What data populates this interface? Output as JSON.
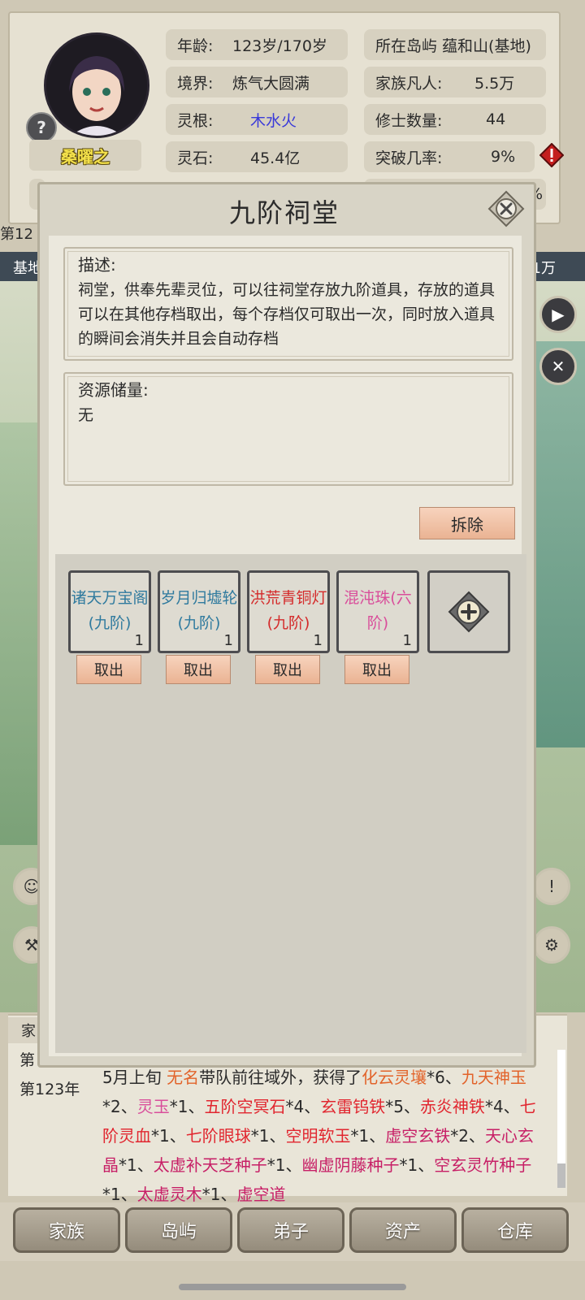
{
  "header": {
    "name": "桑曜之",
    "help": "?",
    "stats": {
      "age_label": "年龄:",
      "age_value": "123岁/170岁",
      "realm_label": "境界:",
      "realm_value": "炼气大圆满",
      "root_label": "灵根:",
      "root_value": "木水火",
      "stone_label": "灵石:",
      "stone_value": "45.4亿",
      "island": "所在岛屿 蕴和山(基地)",
      "mortals_label": "家族凡人:",
      "mortals_value": "5.5万",
      "cultivators_label": "修士数量:",
      "cultivators_value": "44",
      "breakthrough_label": "突破几率:",
      "breakthrough_value": "9%"
    },
    "partial_right_text": "%",
    "side_left_text": "第12",
    "base_bar_left": "基地",
    "base_bar_right": "1万"
  },
  "dialog": {
    "title": "九阶祠堂",
    "desc_label": "描述:",
    "desc_text": "祠堂，供奉先辈灵位，可以往祠堂存放九阶道具，存放的道具可以在其他存档取出，每个存档仅可取出一次，同时放入道具的瞬间会消失并且会自动存档",
    "resource_label": "资源储量:",
    "resource_value": "无",
    "dismantle": "拆除",
    "take_label": "取出",
    "items": [
      {
        "name": "诸天万宝阁(九阶)",
        "count": "1",
        "color": "#2f7a9e"
      },
      {
        "name": "岁月归墟轮(九阶)",
        "count": "1",
        "color": "#2f7a9e"
      },
      {
        "name": "洪荒青铜灯(九阶)",
        "count": "1",
        "color": "#d42a2a"
      },
      {
        "name": "混沌珠(六阶)",
        "count": "1",
        "color": "#d94e9b"
      }
    ]
  },
  "log": {
    "tab": "家",
    "year_prev": "第",
    "year": "第123年",
    "line": "5月上旬 无名带队前往域外，获得了化云灵壤*6、九天神玉*2、灵玉*1、五阶空冥石*4、玄雷钨铁*5、赤炎神铁*4、七阶灵血*1、七阶眼球*1、空明软玉*1、虚空玄铁*2、天心玄晶*1、太虚补天芝种子*1、幽虚阴藤种子*1、空玄灵竹种子*1、太虚灵木*1、虚空道",
    "segments": [
      {
        "t": "5月上旬 ",
        "c": ""
      },
      {
        "t": "无名",
        "c": "o"
      },
      {
        "t": "带队前往域外，获得了",
        "c": ""
      },
      {
        "t": "化云灵壤",
        "c": "o"
      },
      {
        "t": "*6、",
        "c": ""
      },
      {
        "t": "九天神玉",
        "c": "o"
      },
      {
        "t": "*2、",
        "c": ""
      },
      {
        "t": "灵玉",
        "c": "p"
      },
      {
        "t": "*1、",
        "c": ""
      },
      {
        "t": "五阶空冥石",
        "c": "r"
      },
      {
        "t": "*4、",
        "c": ""
      },
      {
        "t": "玄雷钨铁",
        "c": "r"
      },
      {
        "t": "*5、",
        "c": ""
      },
      {
        "t": "赤炎神铁",
        "c": "r"
      },
      {
        "t": "*4、",
        "c": ""
      },
      {
        "t": "七阶灵血",
        "c": "r"
      },
      {
        "t": "*1、",
        "c": ""
      },
      {
        "t": "七阶眼球",
        "c": "r"
      },
      {
        "t": "*1、",
        "c": ""
      },
      {
        "t": "空明软玉",
        "c": "r"
      },
      {
        "t": "*1、",
        "c": ""
      },
      {
        "t": "虚空玄铁",
        "c": "m"
      },
      {
        "t": "*2、",
        "c": ""
      },
      {
        "t": "天心玄晶",
        "c": "m"
      },
      {
        "t": "*1、",
        "c": ""
      },
      {
        "t": "太虚补天芝种子",
        "c": "m"
      },
      {
        "t": "*1、",
        "c": ""
      },
      {
        "t": "幽虚阴藤种子",
        "c": "m"
      },
      {
        "t": "*1、",
        "c": ""
      },
      {
        "t": "空玄灵竹种子",
        "c": "m"
      },
      {
        "t": "*1、",
        "c": ""
      },
      {
        "t": "太虚灵木",
        "c": "m"
      },
      {
        "t": "*1、",
        "c": ""
      },
      {
        "t": "虚空道",
        "c": "m"
      }
    ]
  },
  "nav": [
    "家族",
    "岛屿",
    "弟子",
    "资产",
    "仓库"
  ],
  "colors": {
    "root_value": "#3a3ad9",
    "take_button_bg": "#f0c2a6",
    "nav_button": "#a59d8d"
  }
}
